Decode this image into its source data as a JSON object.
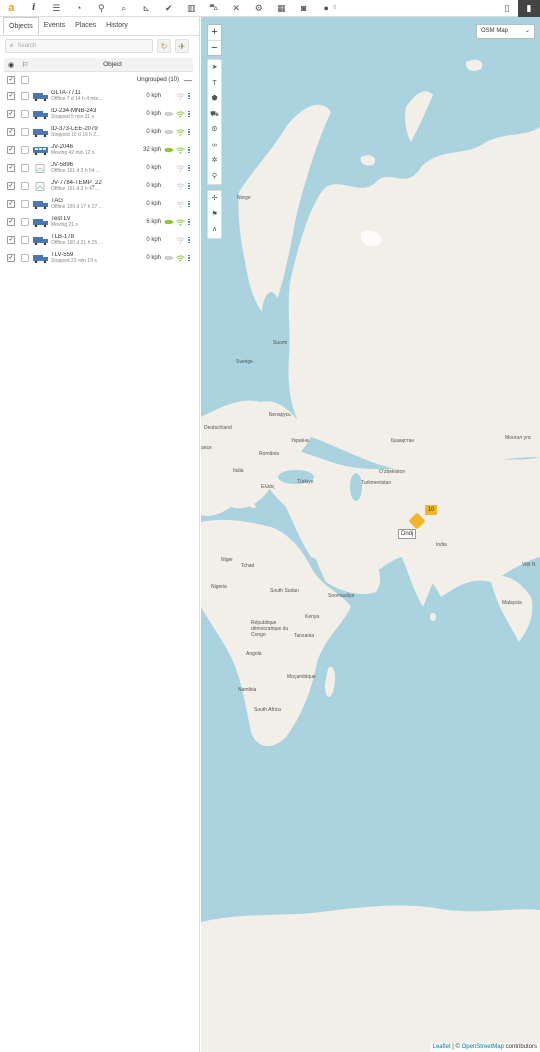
{
  "toolbar": {
    "logo": "a",
    "notification_count": "0",
    "icons": [
      "info-icon",
      "settings-icon",
      "speedometer-icon",
      "map-pin-icon",
      "search-icon",
      "chart-icon",
      "check-icon",
      "book-icon",
      "car-icon",
      "tools-icon",
      "gear-icon",
      "calendar-icon",
      "camera-icon",
      "chat-icon"
    ]
  },
  "tabs": [
    {
      "label": "Objects",
      "active": true
    },
    {
      "label": "Events",
      "active": false
    },
    {
      "label": "Places",
      "active": false
    },
    {
      "label": "History",
      "active": false
    }
  ],
  "search": {
    "placeholder": "Search"
  },
  "table": {
    "object_header": "Object"
  },
  "group": {
    "label": "Ungrouped (10)",
    "collapse": "—"
  },
  "objects": [
    {
      "name": "GLTA-7711",
      "status": "Offline 7 d 14 h 4 min...",
      "speed": "0 kph",
      "icon": "truck",
      "engine": "none",
      "signal": "off"
    },
    {
      "name": "ID-234-MNB-243",
      "status": "Stopped 5 min 31 s",
      "speed": "0 kph",
      "icon": "truck",
      "engine": "off",
      "signal": "on"
    },
    {
      "name": "ID-373-LEE-2079",
      "status": "Stopped 10 d 19 h 2...",
      "speed": "0 kph",
      "icon": "truck",
      "engine": "off",
      "signal": "on"
    },
    {
      "name": "JV-2046",
      "status": "Moving 42 min 12 s",
      "speed": "32 kph",
      "icon": "bus",
      "engine": "on",
      "signal": "on"
    },
    {
      "name": "JV-5896",
      "status": "Offline 161 d 3 h 54 ...",
      "speed": "0 kph",
      "icon": "broken",
      "engine": "none",
      "signal": "off"
    },
    {
      "name": "JV-7784-TEMP_22",
      "status": "Offline 161 d 3 h 47...",
      "speed": "0 kph",
      "icon": "broken",
      "engine": "none",
      "signal": "off"
    },
    {
      "name": "TAG",
      "status": "Offline 109 d 17 h 27 ...",
      "speed": "0 kph",
      "icon": "truck",
      "engine": "none",
      "signal": "off"
    },
    {
      "name": "Test LV",
      "status": "Moving 21 s",
      "speed": "6 kph",
      "icon": "truck",
      "engine": "on",
      "signal": "on"
    },
    {
      "name": "TLB-178",
      "status": "Offline 160 d 21 h 25 ...",
      "speed": "0 kph",
      "icon": "truck",
      "engine": "none",
      "signal": "off"
    },
    {
      "name": "TLV-559",
      "status": "Stopped 23 min 19 s",
      "speed": "0 kph",
      "icon": "truck",
      "engine": "off",
      "signal": "on"
    }
  ],
  "map": {
    "type_label": "OSM Map",
    "marker_label": "Dndj",
    "cluster_count": "10",
    "attribution_leaflet": "Leaflet",
    "attribution_sep": " | © ",
    "attribution_osm": "OpenStreetMap",
    "attribution_tail": " contributors",
    "labels": {
      "norge": "Norge",
      "suomi": "Suomi",
      "sverige": "Sverige",
      "belarus": "Беларусь",
      "deutschland": "Deutschland",
      "ukraina": "Україна",
      "romania": "România",
      "kazakhstan": "Қазақстан",
      "italia": "Italia",
      "turkiye": "Türkiye",
      "uzbekistan": "Oʻzbekiston",
      "turkmenistan": "Turkmenistan",
      "ellas": "Ελλάς",
      "india": "India",
      "mongol": "Монгол улс",
      "niger": "Niger",
      "tchad": "Tchad",
      "nigeria": "Nigeria",
      "south_sudan": "South Sudan",
      "somaliya": "Soomaaliya",
      "kenya": "Kenya",
      "rdc": "République démocratique du Congo",
      "tanzania": "Tanzania",
      "angola": "Angola",
      "mocambique": "Moçambique",
      "namibia": "Namibia",
      "south_africa": "South Africa",
      "france": "ance",
      "malaysia": "Malaysia",
      "viet": "Việt N"
    }
  },
  "colors": {
    "accent": "#f39a1e",
    "water": "#aad3df",
    "land": "#f2efe9",
    "moving": "#8cc63f",
    "link": "#3f73b8"
  }
}
